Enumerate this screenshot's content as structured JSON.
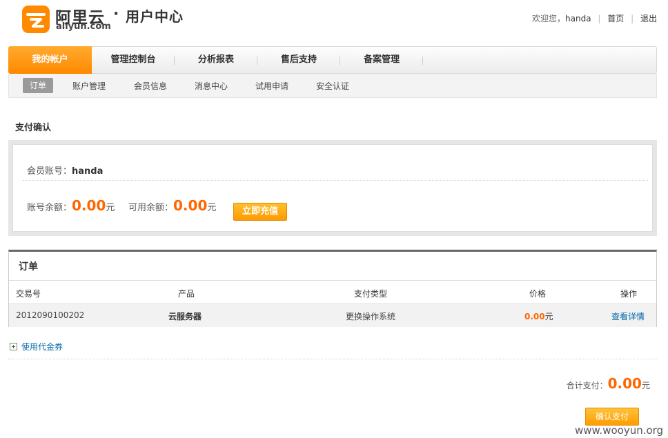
{
  "header": {
    "logo_cn": "阿里云",
    "logo_en": "aliyun.com",
    "logo_dot": "·",
    "logo_sub": "用户中心",
    "welcome": "欢迎您，",
    "username": "handa",
    "home_link": "首页",
    "logout_link": "退出"
  },
  "mainnav": {
    "tabs": [
      {
        "label": "我的帐户"
      },
      {
        "label": "管理控制台"
      },
      {
        "label": "分析报表"
      },
      {
        "label": "售后支持"
      },
      {
        "label": "备案管理"
      }
    ]
  },
  "subnav": {
    "items": [
      {
        "label": "订单"
      },
      {
        "label": "账户管理"
      },
      {
        "label": "会员信息"
      },
      {
        "label": "消息中心"
      },
      {
        "label": "试用申请"
      },
      {
        "label": "安全认证"
      }
    ]
  },
  "payment": {
    "title": "支付确认",
    "member_label": "会员账号：",
    "member_value": "handa",
    "balance_label": "账号余额：",
    "balance_value": "0.00",
    "available_label": "可用余额：",
    "available_value": "0.00",
    "currency": "元",
    "recharge_button": "立即充值"
  },
  "orders": {
    "title": "订单",
    "columns": [
      "交易号",
      "产品",
      "支付类型",
      "价格",
      "操作"
    ],
    "rows": [
      {
        "txn_id": "2012090100202",
        "product": "云服务器",
        "pay_type": "更换操作系统",
        "price": "0.00",
        "currency": "元",
        "action": "查看详情"
      }
    ]
  },
  "coupon": {
    "label": "使用代金券"
  },
  "summary": {
    "total_label": "合计支付：",
    "total_value": "0.00",
    "currency": "元",
    "confirm_button": "确认支付"
  },
  "watermark": "www.wooyun.org",
  "colors": {
    "accent": "#ff9000",
    "price": "#ff6600",
    "link": "#0066aa"
  }
}
